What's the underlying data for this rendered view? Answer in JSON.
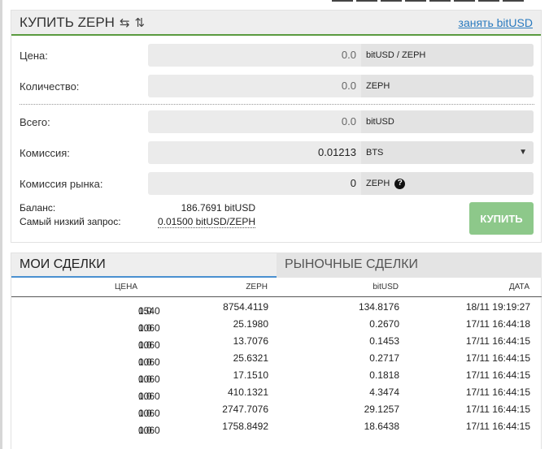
{
  "buy": {
    "title": "КУПИТЬ ZEPH",
    "swap_icon": "⇆",
    "sort_icon": "⇅",
    "borrow_link": "занять bitUSD",
    "price": {
      "label": "Цена:",
      "value": "0.0",
      "unit": "bitUSD / ZEPH"
    },
    "quantity": {
      "label": "Количество:",
      "value": "0.0",
      "unit": "ZEPH"
    },
    "total": {
      "label": "Всего:",
      "value": "0.0",
      "unit": "bitUSD"
    },
    "fee": {
      "label": "Комиссия:",
      "value": "0.01213",
      "unit": "BTS",
      "caret": "▼"
    },
    "market_fee": {
      "label": "Комиссия рынка:",
      "value": "0",
      "unit": "ZEPH",
      "help": "?"
    },
    "balance": {
      "label": "Баланс:",
      "value": "186.7691 bitUSD"
    },
    "lowest_ask": {
      "label": "Самый низкий запрос:",
      "value": "0.01500 bitUSD/ZEPH"
    },
    "button": "КУПИТЬ"
  },
  "trades": {
    "tabs": {
      "mine": "МОИ СДЕЛКИ",
      "market": "РЫНОЧНЫЕ СДЕЛКИ"
    },
    "columns": {
      "price": "ЦЕНА",
      "zeph": "ZEPH",
      "bitusd": "bitUSD",
      "date": "ДАТА"
    },
    "rows": [
      {
        "price_prefix": "0.0",
        "price_main": "1540",
        "color": "red",
        "zeph": "8754.4119",
        "bitusd": "134.8176",
        "date": "18/11 19:19:27"
      },
      {
        "price_prefix": "0.0",
        "price_main": "1060",
        "color": "green",
        "zeph": "25.1980",
        "bitusd": "0.2670",
        "date": "17/11 16:44:18"
      },
      {
        "price_prefix": "0.0",
        "price_main": "1060",
        "color": "green",
        "zeph": "13.7076",
        "bitusd": "0.1453",
        "date": "17/11 16:44:15"
      },
      {
        "price_prefix": "0.0",
        "price_main": "1060",
        "color": "green",
        "zeph": "25.6321",
        "bitusd": "0.2717",
        "date": "17/11 16:44:15"
      },
      {
        "price_prefix": "0.0",
        "price_main": "1060",
        "color": "green",
        "zeph": "17.1510",
        "bitusd": "0.1818",
        "date": "17/11 16:44:15"
      },
      {
        "price_prefix": "0.0",
        "price_main": "1060",
        "color": "green",
        "zeph": "410.1321",
        "bitusd": "4.3474",
        "date": "17/11 16:44:15"
      },
      {
        "price_prefix": "0.0",
        "price_main": "1060",
        "color": "green",
        "zeph": "2747.7076",
        "bitusd": "29.1257",
        "date": "17/11 16:44:15"
      },
      {
        "price_prefix": "0.0",
        "price_main": "1060",
        "color": "green",
        "zeph": "1758.8492",
        "bitusd": "18.6438",
        "date": "17/11 16:44:15"
      }
    ]
  },
  "colors": {
    "accent_green": "#5a9a3f",
    "button_green": "#8dc88a",
    "link_blue": "#2b7bbf",
    "red": "#d63a1e",
    "green": "#2a8a24"
  }
}
